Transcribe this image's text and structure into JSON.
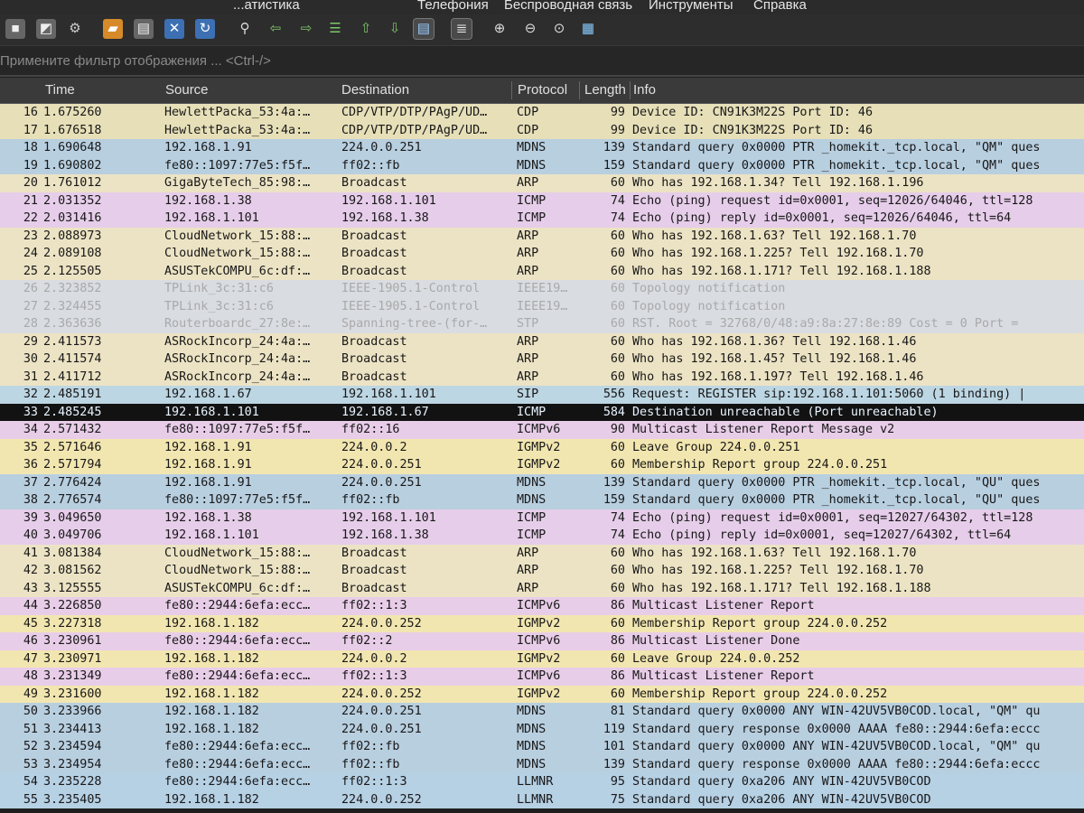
{
  "menu": {
    "items": [
      "...атистика",
      "Телефония",
      "Беспроводная связь",
      "Инструменты",
      "Справка"
    ]
  },
  "toolbar": {
    "icons": [
      "stop-capture-icon",
      "capture-options-icon",
      "restart-capture-icon",
      "open-file-icon",
      "save-file-icon",
      "close-file-icon",
      "reload-file-icon",
      "find-packet-icon",
      "go-back-icon",
      "go-forward-icon",
      "go-to-packet-icon",
      "first-packet-icon",
      "last-packet-icon",
      "autoscroll-icon",
      "colorize-icon",
      "zoom-in-icon",
      "zoom-out-icon",
      "normal-size-icon",
      "resize-columns-icon"
    ]
  },
  "filter": {
    "placeholder": "Примените фильтр отображения ... <Ctrl-/>"
  },
  "columns": {
    "time": "Time",
    "source": "Source",
    "destination": "Destination",
    "protocol": "Protocol",
    "length": "Length",
    "info": "Info"
  },
  "colors": {
    "cdp": "#e6dfb8",
    "mdns": "#b8cfe0",
    "arp": "#ece3c4",
    "icmp": "#e6cdea",
    "stp_faded": "#d9dce1",
    "sip": "#bdd6e3",
    "igmp": "#f2e6b0",
    "icmpv6": "#e8cde8",
    "llmnr": "#b6d0e4",
    "selected": "#121212"
  },
  "packets": [
    {
      "no": "16",
      "time": "1.675260",
      "src": "HewlettPacka_53:4a:…",
      "dst": "CDP/VTP/DTP/PAgP/UD…",
      "proto": "CDP",
      "len": "99",
      "info": "Device ID: CN91K3M22S  Port ID: 46",
      "color": "cdp"
    },
    {
      "no": "17",
      "time": "1.676518",
      "src": "HewlettPacka_53:4a:…",
      "dst": "CDP/VTP/DTP/PAgP/UD…",
      "proto": "CDP",
      "len": "99",
      "info": "Device ID: CN91K3M22S  Port ID: 46",
      "color": "cdp"
    },
    {
      "no": "18",
      "time": "1.690648",
      "src": "192.168.1.91",
      "dst": "224.0.0.251",
      "proto": "MDNS",
      "len": "139",
      "info": "Standard query 0x0000 PTR _homekit._tcp.local, \"QM\" ques",
      "color": "mdns"
    },
    {
      "no": "19",
      "time": "1.690802",
      "src": "fe80::1097:77e5:f5f…",
      "dst": "ff02::fb",
      "proto": "MDNS",
      "len": "159",
      "info": "Standard query 0x0000 PTR _homekit._tcp.local, \"QM\" ques",
      "color": "mdns"
    },
    {
      "no": "20",
      "time": "1.761012",
      "src": "GigaByteTech_85:98:…",
      "dst": "Broadcast",
      "proto": "ARP",
      "len": "60",
      "info": "Who has 192.168.1.34? Tell 192.168.1.196",
      "color": "arp"
    },
    {
      "no": "21",
      "time": "2.031352",
      "src": "192.168.1.38",
      "dst": "192.168.1.101",
      "proto": "ICMP",
      "len": "74",
      "info": "Echo (ping) request  id=0x0001, seq=12026/64046, ttl=128",
      "color": "icmp"
    },
    {
      "no": "22",
      "time": "2.031416",
      "src": "192.168.1.101",
      "dst": "192.168.1.38",
      "proto": "ICMP",
      "len": "74",
      "info": "Echo (ping) reply    id=0x0001, seq=12026/64046, ttl=64",
      "color": "icmp"
    },
    {
      "no": "23",
      "time": "2.088973",
      "src": "CloudNetwork_15:88:…",
      "dst": "Broadcast",
      "proto": "ARP",
      "len": "60",
      "info": "Who has 192.168.1.63? Tell 192.168.1.70",
      "color": "arp"
    },
    {
      "no": "24",
      "time": "2.089108",
      "src": "CloudNetwork_15:88:…",
      "dst": "Broadcast",
      "proto": "ARP",
      "len": "60",
      "info": "Who has 192.168.1.225? Tell 192.168.1.70",
      "color": "arp"
    },
    {
      "no": "25",
      "time": "2.125505",
      "src": "ASUSTekCOMPU_6c:df:…",
      "dst": "Broadcast",
      "proto": "ARP",
      "len": "60",
      "info": "Who has 192.168.1.171? Tell 192.168.1.188",
      "color": "arp"
    },
    {
      "no": "26",
      "time": "2.323852",
      "src": "TPLink_3c:31:c6",
      "dst": "IEEE-1905.1-Control",
      "proto": "IEEE19…",
      "len": "60",
      "info": "Topology notification",
      "color": "stp_faded",
      "faded": true
    },
    {
      "no": "27",
      "time": "2.324455",
      "src": "TPLink_3c:31:c6",
      "dst": "IEEE-1905.1-Control",
      "proto": "IEEE19…",
      "len": "60",
      "info": "Topology notification",
      "color": "stp_faded",
      "faded": true
    },
    {
      "no": "28",
      "time": "2.363636",
      "src": "Routerboardc_27:8e:…",
      "dst": "Spanning-tree-(for-…",
      "proto": "STP",
      "len": "60",
      "info": "RST. Root = 32768/0/48:a9:8a:27:8e:89  Cost = 0  Port =",
      "color": "stp_faded",
      "faded": true
    },
    {
      "no": "29",
      "time": "2.411573",
      "src": "ASRockIncorp_24:4a:…",
      "dst": "Broadcast",
      "proto": "ARP",
      "len": "60",
      "info": "Who has 192.168.1.36? Tell 192.168.1.46",
      "color": "arp"
    },
    {
      "no": "30",
      "time": "2.411574",
      "src": "ASRockIncorp_24:4a:…",
      "dst": "Broadcast",
      "proto": "ARP",
      "len": "60",
      "info": "Who has 192.168.1.45? Tell 192.168.1.46",
      "color": "arp"
    },
    {
      "no": "31",
      "time": "2.411712",
      "src": "ASRockIncorp_24:4a:…",
      "dst": "Broadcast",
      "proto": "ARP",
      "len": "60",
      "info": "Who has 192.168.1.197? Tell 192.168.1.46",
      "color": "arp"
    },
    {
      "no": "32",
      "time": "2.485191",
      "src": "192.168.1.67",
      "dst": "192.168.1.101",
      "proto": "SIP",
      "len": "556",
      "info": "Request: REGISTER sip:192.168.1.101:5060  (1 binding) |",
      "color": "sip"
    },
    {
      "no": "33",
      "time": "2.485245",
      "src": "192.168.1.101",
      "dst": "192.168.1.67",
      "proto": "ICMP",
      "len": "584",
      "info": "Destination unreachable (Port unreachable)",
      "color": "selected",
      "selected": true
    },
    {
      "no": "34",
      "time": "2.571432",
      "src": "fe80::1097:77e5:f5f…",
      "dst": "ff02::16",
      "proto": "ICMPv6",
      "len": "90",
      "info": "Multicast Listener Report Message v2",
      "color": "icmpv6"
    },
    {
      "no": "35",
      "time": "2.571646",
      "src": "192.168.1.91",
      "dst": "224.0.0.2",
      "proto": "IGMPv2",
      "len": "60",
      "info": "Leave Group 224.0.0.251",
      "color": "igmp"
    },
    {
      "no": "36",
      "time": "2.571794",
      "src": "192.168.1.91",
      "dst": "224.0.0.251",
      "proto": "IGMPv2",
      "len": "60",
      "info": "Membership Report group 224.0.0.251",
      "color": "igmp"
    },
    {
      "no": "37",
      "time": "2.776424",
      "src": "192.168.1.91",
      "dst": "224.0.0.251",
      "proto": "MDNS",
      "len": "139",
      "info": "Standard query 0x0000 PTR _homekit._tcp.local, \"QU\" ques",
      "color": "mdns"
    },
    {
      "no": "38",
      "time": "2.776574",
      "src": "fe80::1097:77e5:f5f…",
      "dst": "ff02::fb",
      "proto": "MDNS",
      "len": "159",
      "info": "Standard query 0x0000 PTR _homekit._tcp.local, \"QU\" ques",
      "color": "mdns"
    },
    {
      "no": "39",
      "time": "3.049650",
      "src": "192.168.1.38",
      "dst": "192.168.1.101",
      "proto": "ICMP",
      "len": "74",
      "info": "Echo (ping) request  id=0x0001, seq=12027/64302, ttl=128",
      "color": "icmp"
    },
    {
      "no": "40",
      "time": "3.049706",
      "src": "192.168.1.101",
      "dst": "192.168.1.38",
      "proto": "ICMP",
      "len": "74",
      "info": "Echo (ping) reply    id=0x0001, seq=12027/64302, ttl=64",
      "color": "icmp"
    },
    {
      "no": "41",
      "time": "3.081384",
      "src": "CloudNetwork_15:88:…",
      "dst": "Broadcast",
      "proto": "ARP",
      "len": "60",
      "info": "Who has 192.168.1.63? Tell 192.168.1.70",
      "color": "arp"
    },
    {
      "no": "42",
      "time": "3.081562",
      "src": "CloudNetwork_15:88:…",
      "dst": "Broadcast",
      "proto": "ARP",
      "len": "60",
      "info": "Who has 192.168.1.225? Tell 192.168.1.70",
      "color": "arp"
    },
    {
      "no": "43",
      "time": "3.125555",
      "src": "ASUSTekCOMPU_6c:df:…",
      "dst": "Broadcast",
      "proto": "ARP",
      "len": "60",
      "info": "Who has 192.168.1.171? Tell 192.168.1.188",
      "color": "arp"
    },
    {
      "no": "44",
      "time": "3.226850",
      "src": "fe80::2944:6efa:ecc…",
      "dst": "ff02::1:3",
      "proto": "ICMPv6",
      "len": "86",
      "info": "Multicast Listener Report",
      "color": "icmpv6"
    },
    {
      "no": "45",
      "time": "3.227318",
      "src": "192.168.1.182",
      "dst": "224.0.0.252",
      "proto": "IGMPv2",
      "len": "60",
      "info": "Membership Report group 224.0.0.252",
      "color": "igmp"
    },
    {
      "no": "46",
      "time": "3.230961",
      "src": "fe80::2944:6efa:ecc…",
      "dst": "ff02::2",
      "proto": "ICMPv6",
      "len": "86",
      "info": "Multicast Listener Done",
      "color": "icmpv6"
    },
    {
      "no": "47",
      "time": "3.230971",
      "src": "192.168.1.182",
      "dst": "224.0.0.2",
      "proto": "IGMPv2",
      "len": "60",
      "info": "Leave Group 224.0.0.252",
      "color": "igmp"
    },
    {
      "no": "48",
      "time": "3.231349",
      "src": "fe80::2944:6efa:ecc…",
      "dst": "ff02::1:3",
      "proto": "ICMPv6",
      "len": "86",
      "info": "Multicast Listener Report",
      "color": "icmpv6"
    },
    {
      "no": "49",
      "time": "3.231600",
      "src": "192.168.1.182",
      "dst": "224.0.0.252",
      "proto": "IGMPv2",
      "len": "60",
      "info": "Membership Report group 224.0.0.252",
      "color": "igmp"
    },
    {
      "no": "50",
      "time": "3.233966",
      "src": "192.168.1.182",
      "dst": "224.0.0.251",
      "proto": "MDNS",
      "len": "81",
      "info": "Standard query 0x0000 ANY WIN-42UV5VB0COD.local, \"QM\" qu",
      "color": "mdns"
    },
    {
      "no": "51",
      "time": "3.234413",
      "src": "192.168.1.182",
      "dst": "224.0.0.251",
      "proto": "MDNS",
      "len": "119",
      "info": "Standard query response 0x0000 AAAA fe80::2944:6efa:eccc",
      "color": "mdns"
    },
    {
      "no": "52",
      "time": "3.234594",
      "src": "fe80::2944:6efa:ecc…",
      "dst": "ff02::fb",
      "proto": "MDNS",
      "len": "101",
      "info": "Standard query 0x0000 ANY WIN-42UV5VB0COD.local, \"QM\" qu",
      "color": "mdns"
    },
    {
      "no": "53",
      "time": "3.234954",
      "src": "fe80::2944:6efa:ecc…",
      "dst": "ff02::fb",
      "proto": "MDNS",
      "len": "139",
      "info": "Standard query response 0x0000 AAAA fe80::2944:6efa:eccc",
      "color": "mdns"
    },
    {
      "no": "54",
      "time": "3.235228",
      "src": "fe80::2944:6efa:ecc…",
      "dst": "ff02::1:3",
      "proto": "LLMNR",
      "len": "95",
      "info": "Standard query 0xa206 ANY WIN-42UV5VB0COD",
      "color": "llmnr"
    },
    {
      "no": "55",
      "time": "3.235405",
      "src": "192.168.1.182",
      "dst": "224.0.0.252",
      "proto": "LLMNR",
      "len": "75",
      "info": "Standard query 0xa206 ANY WIN-42UV5VB0COD",
      "color": "llmnr"
    }
  ]
}
